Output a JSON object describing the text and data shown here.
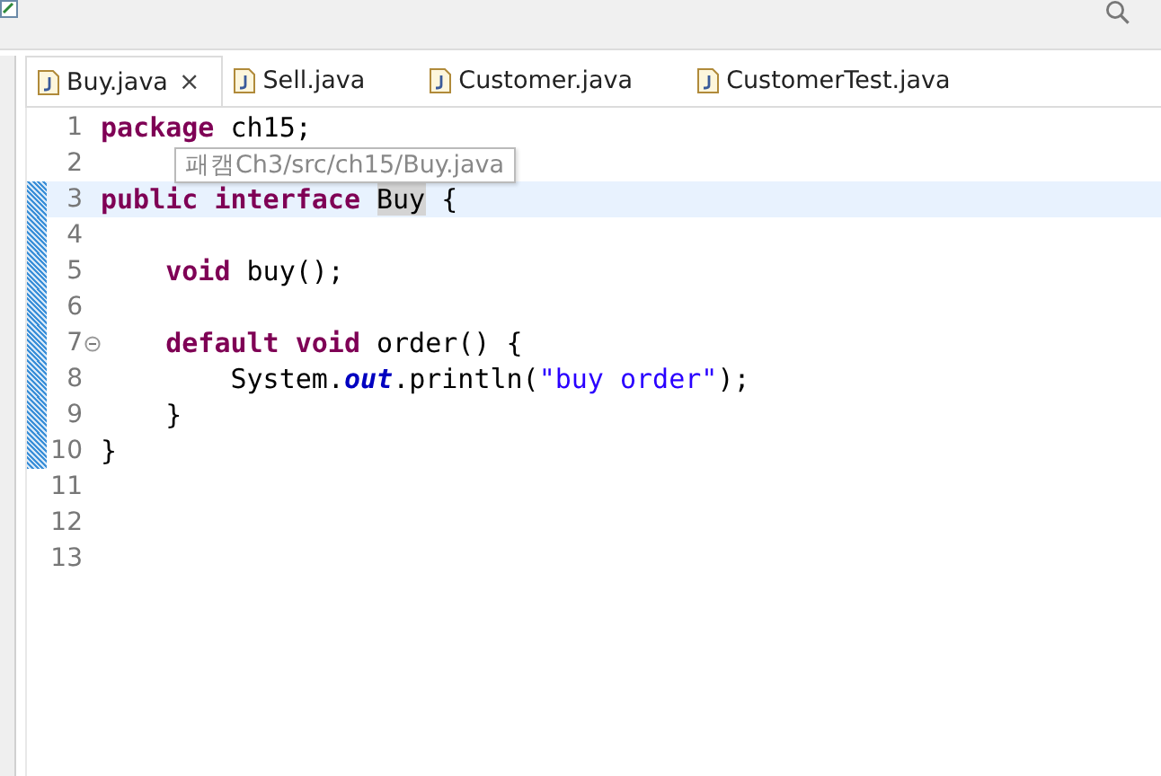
{
  "tabs": [
    {
      "label": "Buy.java",
      "selected": true,
      "close": "×"
    },
    {
      "label": "Sell.java",
      "selected": false
    },
    {
      "label": "Customer.java",
      "selected": false
    },
    {
      "label": "CustomerTest.java",
      "selected": false
    }
  ],
  "editor": {
    "lines": [
      {
        "number": "1",
        "changed": false,
        "current": false,
        "tokens": [
          {
            "kind": "keyword",
            "text": "package"
          },
          {
            "kind": "plain",
            "text": "ch15;",
            "space_before": true
          }
        ]
      },
      {
        "number": "2",
        "changed": false,
        "current": false
      },
      {
        "number": "3",
        "changed": true,
        "current": true,
        "tokens": [
          {
            "kind": "keyword",
            "text": "public"
          },
          {
            "kind": "keyword",
            "text": "interface",
            "space_before": true
          },
          {
            "kind": "occurrence",
            "text": "Buy",
            "space_before": true
          },
          {
            "kind": "plain",
            "text": "{",
            "space_before": true
          }
        ],
        "children": [
          {
            "number": "4",
            "changed": true,
            "current": false
          },
          {
            "number": "5",
            "changed": true,
            "current": false,
            "tokens": [
              {
                "kind": "keyword",
                "text": "void"
              },
              {
                "kind": "plain",
                "text": "buy();",
                "space_before": true
              }
            ]
          },
          {
            "number": "6",
            "changed": true,
            "current": false
          },
          {
            "number": "7",
            "changed": true,
            "current": false,
            "fold_expanded": true,
            "tokens": [
              {
                "kind": "keyword",
                "text": "default"
              },
              {
                "kind": "keyword",
                "text": "void",
                "space_before": true
              },
              {
                "kind": "plain",
                "text": "order() {",
                "space_before": true
              }
            ],
            "children": [
              {
                "number": "8",
                "changed": true,
                "current": false,
                "tokens": [
                  {
                    "kind": "plain",
                    "text": "System."
                  },
                  {
                    "kind": "field",
                    "text": "out"
                  },
                  {
                    "kind": "plain",
                    "text": ".println("
                  },
                  {
                    "kind": "string",
                    "text": "\"buy order\""
                  },
                  {
                    "kind": "plain",
                    "text": ");"
                  }
                ]
              }
            ]
          },
          {
            "number": "9",
            "changed": true,
            "current": false,
            "tokens": [
              {
                "kind": "plain",
                "text": "}"
              }
            ]
          }
        ]
      },
      {
        "number": "10",
        "changed": true,
        "current": false,
        "tokens": [
          {
            "kind": "plain",
            "text": "}"
          }
        ]
      },
      {
        "number": "11",
        "changed": false,
        "current": false
      },
      {
        "number": "12",
        "changed": false,
        "current": false
      },
      {
        "number": "13",
        "changed": false,
        "current": false
      }
    ],
    "tooltip": "패캠Ch3/src/ch15/Buy.java"
  }
}
